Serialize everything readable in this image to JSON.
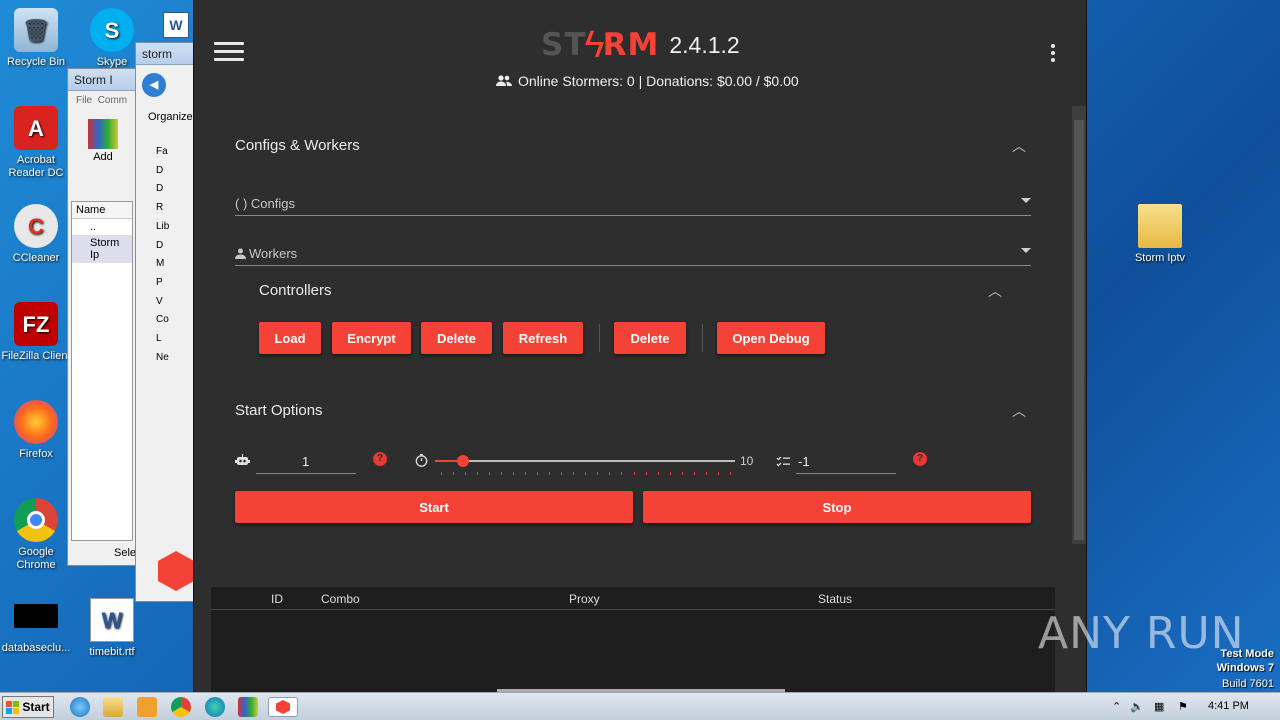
{
  "desktop": {
    "icons": [
      {
        "label": "Recycle Bin"
      },
      {
        "label": "Skype"
      },
      {
        "label": "Acrobat Reader DC"
      },
      {
        "label": "CCleaner"
      },
      {
        "label": "FileZilla Client"
      },
      {
        "label": "Firefox"
      },
      {
        "label": "Google Chrome"
      },
      {
        "label": "databaseclu..."
      },
      {
        "label": "timebit.rtf"
      },
      {
        "label": "Storm Iptv"
      }
    ]
  },
  "bg_windows": {
    "winrar_title": "Storm I",
    "winrar_menu": [
      "File",
      "Comm"
    ],
    "winrar_add": "Add",
    "winrar_col": "Name",
    "winrar_rows": [
      "..",
      "Storm Ip"
    ],
    "winrar_status": "Sele",
    "explorer_title": "storm",
    "explorer_organize": "Organize",
    "explorer_tree": [
      "Fa",
      "D",
      "D",
      "R",
      "Lib",
      "D",
      "M",
      "P",
      "V",
      "Co",
      "L",
      "Ne"
    ]
  },
  "app": {
    "logo_left": "ST",
    "logo_right": "RM",
    "version": "2.4.1.2",
    "stats": "Online Stormers: 0 | Donations: $0.00 / $0.00",
    "configs_workers": {
      "title": "Configs & Workers",
      "configs_label": "( ) Configs",
      "workers_label": "Workers"
    },
    "controllers": {
      "title": "Controllers",
      "buttons": [
        "Load",
        "Encrypt",
        "Delete",
        "Refresh",
        "Delete",
        "Open Debug"
      ]
    },
    "start_options": {
      "title": "Start Options",
      "bots_value": "1",
      "slider_value": 1,
      "slider_max_label": "10",
      "retries_value": "-1",
      "start_label": "Start",
      "stop_label": "Stop"
    },
    "table": {
      "headers": [
        "ID",
        "Combo",
        "Proxy",
        "Status"
      ]
    }
  },
  "taskbar": {
    "start_label": "Start",
    "clock": "4:41 PM"
  },
  "overlay": {
    "watermark": "ANY RUN",
    "test_mode": "Test Mode",
    "os": "Windows 7",
    "build": "Build 7601"
  }
}
